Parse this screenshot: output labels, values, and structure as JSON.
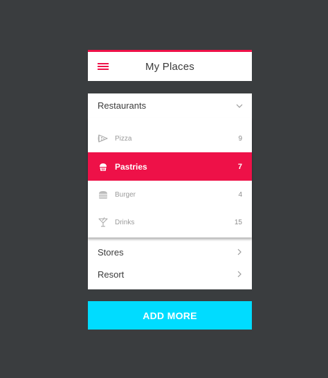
{
  "colors": {
    "background": "#3a3d3f",
    "accent": "#ee1148",
    "button": "#00dcff",
    "card": "#ffffff"
  },
  "header": {
    "title": "My Places",
    "menu_icon": "hamburger-menu-icon"
  },
  "restaurants": {
    "label": "Restaurants",
    "expanded": true,
    "toggle_icon": "chevron-down-icon",
    "items": [
      {
        "label": "Pizza",
        "count": "9",
        "icon": "pizza-slice-icon",
        "active": false
      },
      {
        "label": "Pastries",
        "count": "7",
        "icon": "cupcake-icon",
        "active": true
      },
      {
        "label": "Burger",
        "count": "4",
        "icon": "burger-icon",
        "active": false
      },
      {
        "label": "Drinks",
        "count": "15",
        "icon": "cocktail-glass-icon",
        "active": false
      }
    ]
  },
  "categories": [
    {
      "label": "Stores",
      "icon": "chevron-right-icon"
    },
    {
      "label": "Resort",
      "icon": "chevron-right-icon"
    }
  ],
  "add_button": {
    "label": "ADD MORE"
  }
}
